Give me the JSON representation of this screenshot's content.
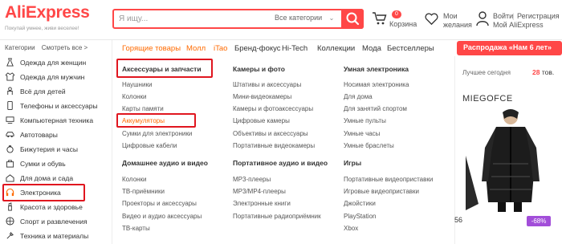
{
  "header": {
    "logo": "AliExpress",
    "tagline": "Покупай умнее, живи веселее!",
    "search_placeholder": "Я ищу...",
    "category_select": "Все категории",
    "cart_count": "0",
    "cart_label": "Корзина",
    "wishlist_line1": "Мои",
    "wishlist_line2": "желания",
    "login": "Войти",
    "separator": "|",
    "register": "Регистрация",
    "my_aliexpress": "Мой AliExpress"
  },
  "sidebar": {
    "categories_label": "Категории",
    "see_all": "Смотреть все >",
    "items": [
      {
        "label": "Одежда для женщин",
        "icon": "dress-icon"
      },
      {
        "label": "Одежда для мужчин",
        "icon": "shirt-icon"
      },
      {
        "label": "Всё для детей",
        "icon": "baby-icon"
      },
      {
        "label": "Телефоны и аксессуары",
        "icon": "phone-icon"
      },
      {
        "label": "Компьютерная техника",
        "icon": "computer-icon"
      },
      {
        "label": "Автотовары",
        "icon": "car-icon"
      },
      {
        "label": "Бижутерия и часы",
        "icon": "ring-icon"
      },
      {
        "label": "Сумки и обувь",
        "icon": "bag-icon"
      },
      {
        "label": "Для дома и сада",
        "icon": "home-icon"
      },
      {
        "label": "Электроника",
        "icon": "headphones-icon"
      },
      {
        "label": "Красота и здоровье",
        "icon": "lipstick-icon"
      },
      {
        "label": "Спорт и развлечения",
        "icon": "ball-icon"
      },
      {
        "label": "Техника и материалы",
        "icon": "tools-icon"
      }
    ]
  },
  "nav": {
    "items": [
      "Горящие товары",
      "Молл",
      "iTao",
      "Бренд-фокус",
      "Hi-Tech",
      "Коллекции",
      "Мода",
      "Бестселлеры"
    ],
    "promo": "Распродажа «Нам 6 лет»"
  },
  "menu": {
    "col1": {
      "heading": "Аксессуары и запчасти",
      "items": [
        "Наушники",
        "Колонки",
        "Карты памяти",
        "Аккумуляторы",
        "Сумки для электроники",
        "Цифровые кабели"
      ],
      "heading2": "Домашнее аудио и видео",
      "items2": [
        "Колонки",
        "ТВ-приёмники",
        "Проекторы и аксессуары",
        "Видео и аудио аксессуары",
        "ТВ-карты"
      ]
    },
    "col2": {
      "heading": "Камеры и фото",
      "items": [
        "Штативы и аксессуары",
        "Мини-видеокамеры",
        "Камеры и фотоаксессуары",
        "Цифровые камеры",
        "Объективы и аксессуары",
        "Портативные видеокамеры"
      ],
      "heading2": "Портативное аудио и видео",
      "items2": [
        "MP3-плееры",
        "MP3/MP4-плееры",
        "Электронные книги",
        "Портативные радиоприёмник"
      ]
    },
    "col3": {
      "heading": "Умная электроника",
      "items": [
        "Носимая электроника",
        "Для дома",
        "Для занятий спортом",
        "Умные пульты",
        "Умные часы",
        "Умные браслеты"
      ],
      "heading2": "Игры",
      "items2": [
        "Портативные видеоприставки",
        "Игровые видеоприставки",
        "Джойстики",
        "PlayStation",
        "Xbox"
      ]
    }
  },
  "right": {
    "best_today": "Лучшее сегодня",
    "count": "28",
    "count_suffix": "тов.",
    "brand": "MIEGOFCE",
    "discount": "-68%",
    "price_fragment": "56"
  },
  "colors": {
    "brand": "#ff4747",
    "accent": "#ff6a00",
    "highlight_box": "#e0161f",
    "discount_badge": "#a24ed9"
  }
}
